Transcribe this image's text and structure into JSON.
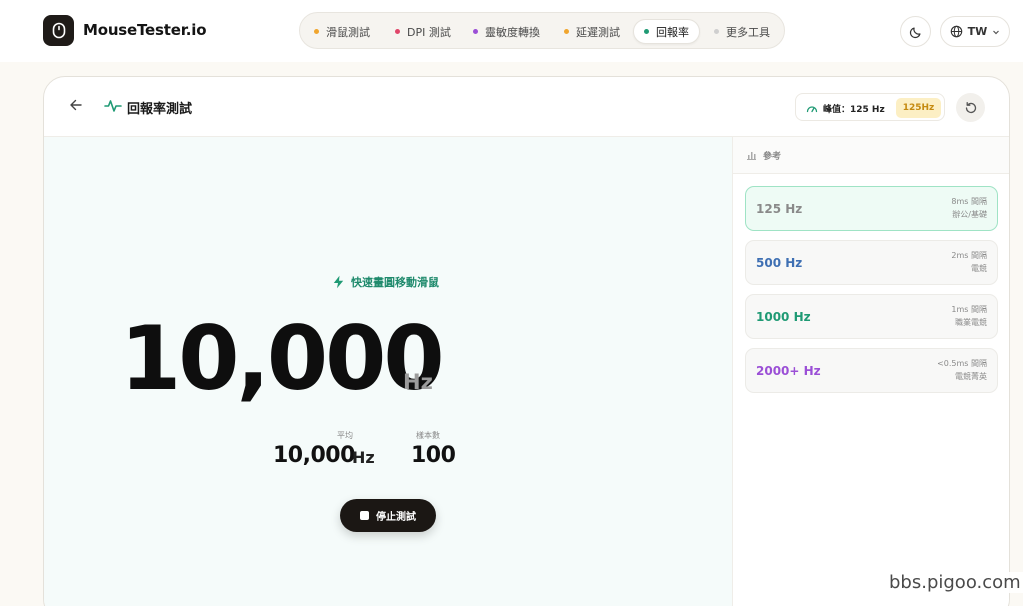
{
  "brand": {
    "name": "MouseTester.io"
  },
  "nav": {
    "items": [
      {
        "label": "滑鼠測試",
        "color": "#f0a52e"
      },
      {
        "label": "DPI 測試",
        "color": "#e0466a"
      },
      {
        "label": "靈敏度轉換",
        "color": "#9b4fd6"
      },
      {
        "label": "延遲測試",
        "color": "#f0a52e"
      },
      {
        "label": "回報率",
        "color": "#1f9a74",
        "active": true
      },
      {
        "label": "更多工具",
        "color": "#cfcfcf"
      }
    ]
  },
  "header_actions": {
    "theme_icon": "moon-icon",
    "lang_label": "TW"
  },
  "card": {
    "title": "回報率測試",
    "peak_label": "峰值：125 Hz",
    "peak_badge": "125Hz"
  },
  "test": {
    "hint": "快速畫圓移動滑鼠",
    "value": "10,000",
    "unit": "Hz",
    "avg_label": "平均",
    "avg_value": "10,000",
    "avg_unit": "Hz",
    "samples_label": "樣本數",
    "samples_value": "100",
    "stop_label": "停止測試"
  },
  "sidebar": {
    "title": "參考",
    "refs": [
      {
        "hz": "125 Hz",
        "ms": "8ms 間隔",
        "use": "辦公/基礎",
        "color": "#8a8a8a",
        "active": true
      },
      {
        "hz": "500 Hz",
        "ms": "2ms 間隔",
        "use": "電競",
        "color": "#3e6fb3"
      },
      {
        "hz": "1000 Hz",
        "ms": "1ms 間隔",
        "use": "職業電競",
        "color": "#1f9a74"
      },
      {
        "hz": "2000+ Hz",
        "ms": "<0.5ms 間隔",
        "use": "電競菁英",
        "color": "#9b4fd6"
      }
    ]
  },
  "watermark": "bbs.pigoo.com"
}
